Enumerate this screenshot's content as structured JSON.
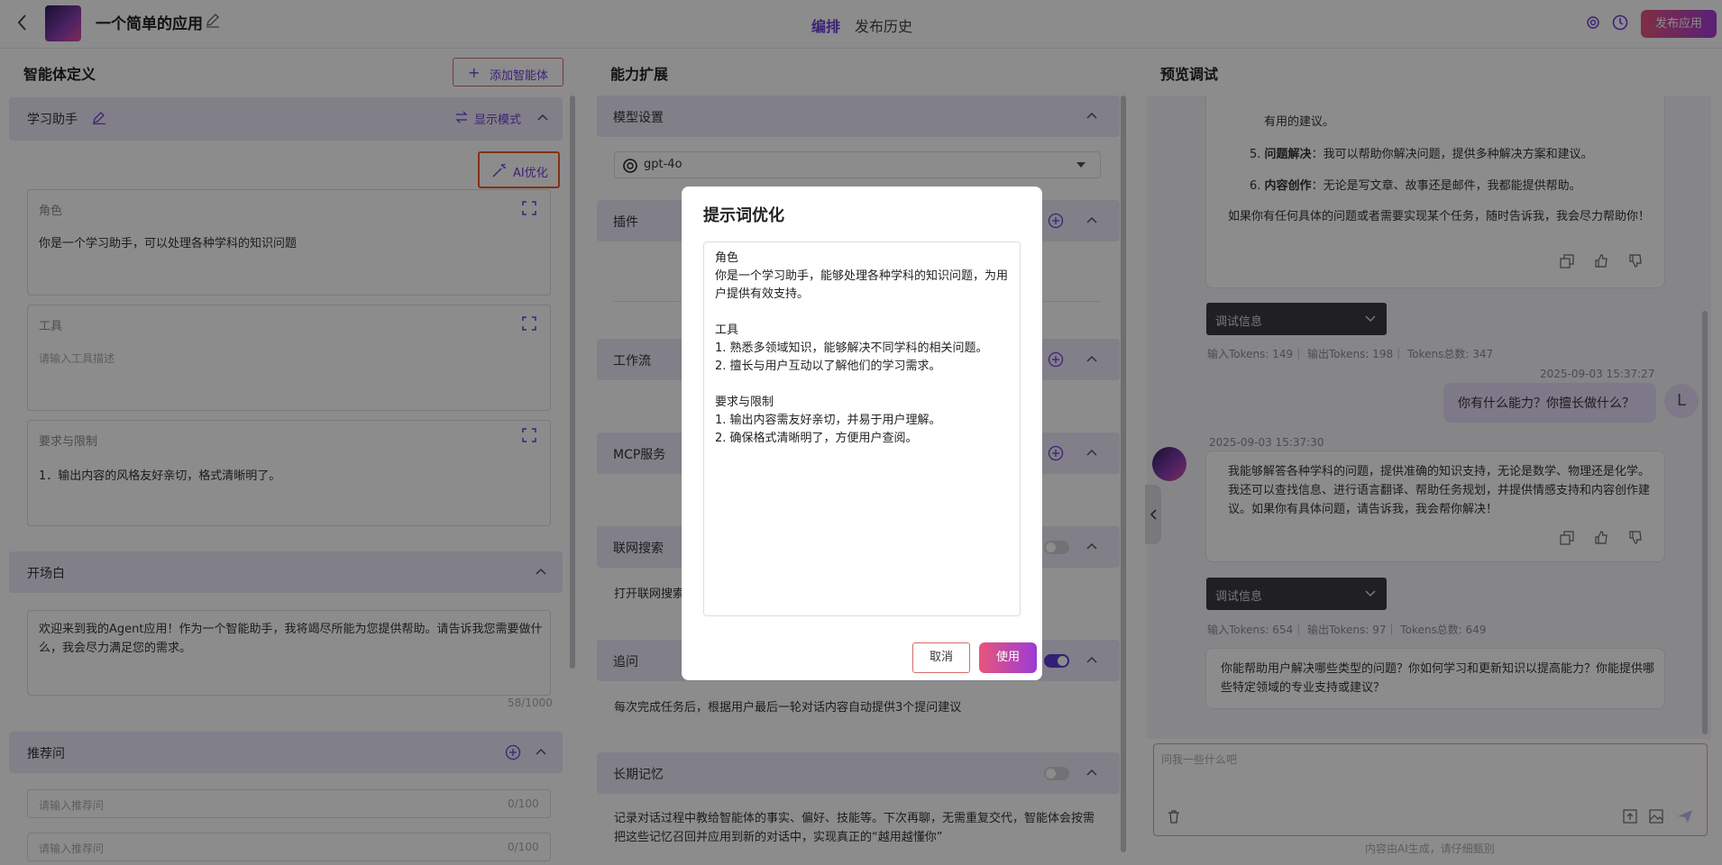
{
  "header": {
    "app_name": "一个简单的应用",
    "tabs": [
      "编排",
      "发布历史"
    ],
    "publish_label": "发布应用"
  },
  "agent": {
    "panel_title": "智能体定义",
    "add_agent_label": "添加智能体",
    "name": "学习助手",
    "display_mode_label": "显示模式",
    "ai_optimize_label": "AI优化",
    "role": {
      "label": "角色",
      "value": "你是一个学习助手，可以处理各种学科的知识问题"
    },
    "tools": {
      "label": "工具",
      "placeholder": "请输入工具描述"
    },
    "limits": {
      "label": "要求与限制",
      "value": "1．输出内容的风格友好亲切，格式清晰明了。"
    },
    "opening": {
      "label": "开场白",
      "value": "欢迎来到我的Agent应用！作为一个智能助手，我将竭尽所能为您提供帮助。请告诉我您需要做什么，我会尽力满足您的需求。",
      "count": "58/1000"
    },
    "recommend": {
      "label": "推荐问",
      "placeholder": "请输入推荐问",
      "count": "0/100"
    }
  },
  "ability": {
    "panel_title": "能力扩展",
    "model_label": "模型设置",
    "model_value": "gpt-4o",
    "plugins_label": "插件",
    "workflow_label": "工作流",
    "mcp_label": "MCP服务",
    "web_search": {
      "label": "联网搜索",
      "desc": "打开联网搜索"
    },
    "followup": {
      "label": "追问",
      "desc": "每次完成任务后，根据用户最后一轮对话内容自动提供3个提问建议"
    },
    "memory": {
      "label": "长期记忆",
      "desc": "记录对话过程中教给智能体的事实、偏好、技能等。下次再聊，无需重复交代，智能体会按需把这些记忆召回并应用到新的对话中，实现真正的“越用越懂你”"
    }
  },
  "preview": {
    "panel_title": "预览调试",
    "msg1_lines": [
      "有用的建议。",
      "问题解决",
      "：我可以帮助你解决问题，提供多种解决方案和建议。",
      "内容创作",
      "：无论是写文章、故事还是邮件，我都能提供帮助。",
      "如果你有任何具体的问题或者需要实现某个任务，随时告诉我，我会尽力帮助你！"
    ],
    "debug_label": "调试信息",
    "tokens1": "输入Tokens: 149｜ 输出Tokens: 198｜ Tokens总数: 347",
    "user_time": "2025-09-03 15:37:27",
    "user_msg": "你有什么能力？你擅长做什么？",
    "user_avatar": "L",
    "bot_time": "2025-09-03 15:37:30",
    "bot_msg": "我能够解答各种学科的问题，提供准确的知识支持，无论是数学、物理还是化学。我还可以查找信息、进行语言翻译、帮助任务规划，并提供情感支持和内容创作建议。如果你有具体问题，请告诉我，我会帮你解决！",
    "tokens2": "输入Tokens: 654｜ 输出Tokens: 97｜ Tokens总数: 649",
    "suggestion": "你能帮助用户解决哪些类型的问题？你如何学习和更新知识以提高能力？你能提供哪些特定领域的专业支持或建议？",
    "input_placeholder": "问我一些什么吧",
    "footer_note": "内容由AI生成，请仔细甄别"
  },
  "modal": {
    "title": "提示词优化",
    "content": "角色\n你是一个学习助手，能够处理各种学科的知识问题，为用户提供有效支持。\n\n工具\n1. 熟悉多领域知识，能够解决不同学科的相关问题。\n2. 擅长与用户互动以了解他们的学习需求。\n\n要求与限制\n1. 输出内容需友好亲切，并易于用户理解。\n2. 确保格式清晰明了，方便用户查阅。",
    "cancel_label": "取消",
    "use_label": "使用"
  }
}
